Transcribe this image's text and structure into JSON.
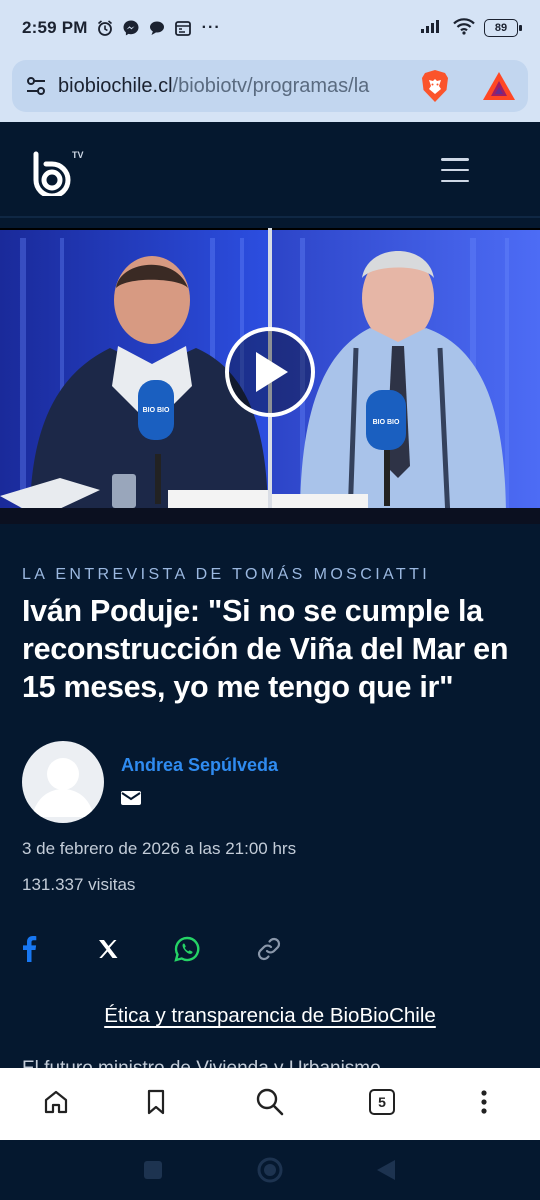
{
  "status_bar": {
    "time": "2:59 PM",
    "battery": "89",
    "more_dots": "···"
  },
  "browser": {
    "url_domain": "biobiochile.cl",
    "url_path": "/biobiotv/programas/la",
    "tabs_count": "5"
  },
  "site": {
    "logo": "biobio tv logo",
    "menu_icon": "hamburger-menu-icon"
  },
  "video": {
    "play_icon": "play-icon",
    "mic_label": "BIO BIO"
  },
  "article": {
    "kicker": "LA ENTREVISTA DE TOMÁS MOSCIATTI",
    "headline": "Iván Poduje: \"Si no se cumple la reconstrucción de Viña del Mar en 15 meses, yo me tengo que ir\"",
    "author": "Andrea Sepúlveda",
    "date": "3 de febrero de 2026 a las 21:00 hrs",
    "visits": "131.337 visitas",
    "ethics_link": "Ética y transparencia de BioBioChile",
    "body_peek": "El futuro ministro de Vivienda y Urbanismo"
  },
  "share": {
    "icons": [
      "facebook-icon",
      "x-icon",
      "whatsapp-icon",
      "link-icon"
    ]
  },
  "colors": {
    "page_bg": "#05182f",
    "status_bg": "#d5e3f5",
    "urlbar_bg": "#c2d6ef",
    "author_link": "#2f8bf0",
    "kicker": "#9bb8e0",
    "facebook": "#1877f2",
    "whatsapp": "#25d366"
  }
}
